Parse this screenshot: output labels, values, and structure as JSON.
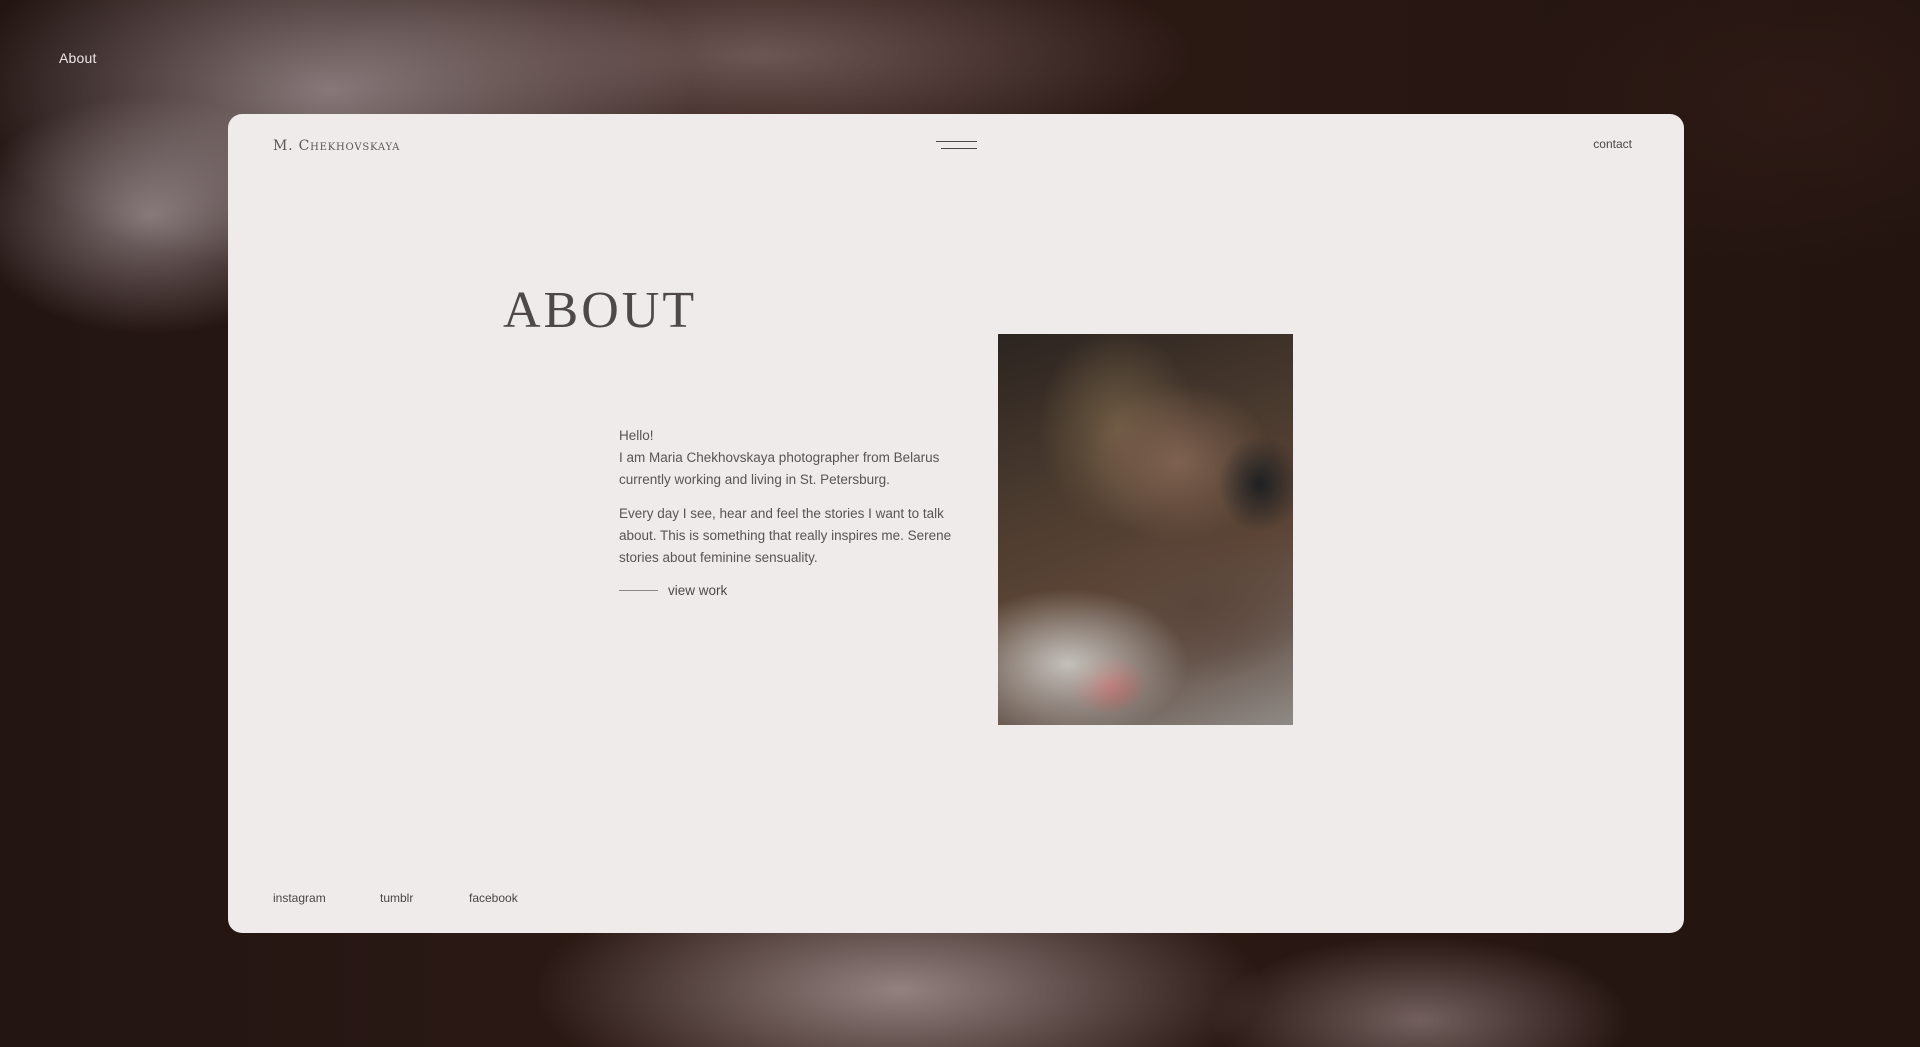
{
  "nav": {
    "corner_label": "About"
  },
  "header": {
    "brand": "M. Chekhovskaya",
    "menu_icon": "hamburger-menu-icon",
    "contact_label": "contact"
  },
  "main": {
    "title": "ABOUT",
    "intro_lines": [
      "Hello!",
      "I am Maria Chekhovskaya photographer from Belarus currently working and living in St. Petersburg."
    ],
    "paragraph2": "Every day I see, hear and feel the stories I want to talk about. This is something that really inspires me. Serene stories about feminine sensuality.",
    "view_work_label": "view work"
  },
  "footer": {
    "social": [
      "instagram",
      "tumblr",
      "facebook"
    ]
  },
  "colors": {
    "card_background": "#efebea",
    "text": "#4e4947",
    "page_background": "#221512"
  }
}
